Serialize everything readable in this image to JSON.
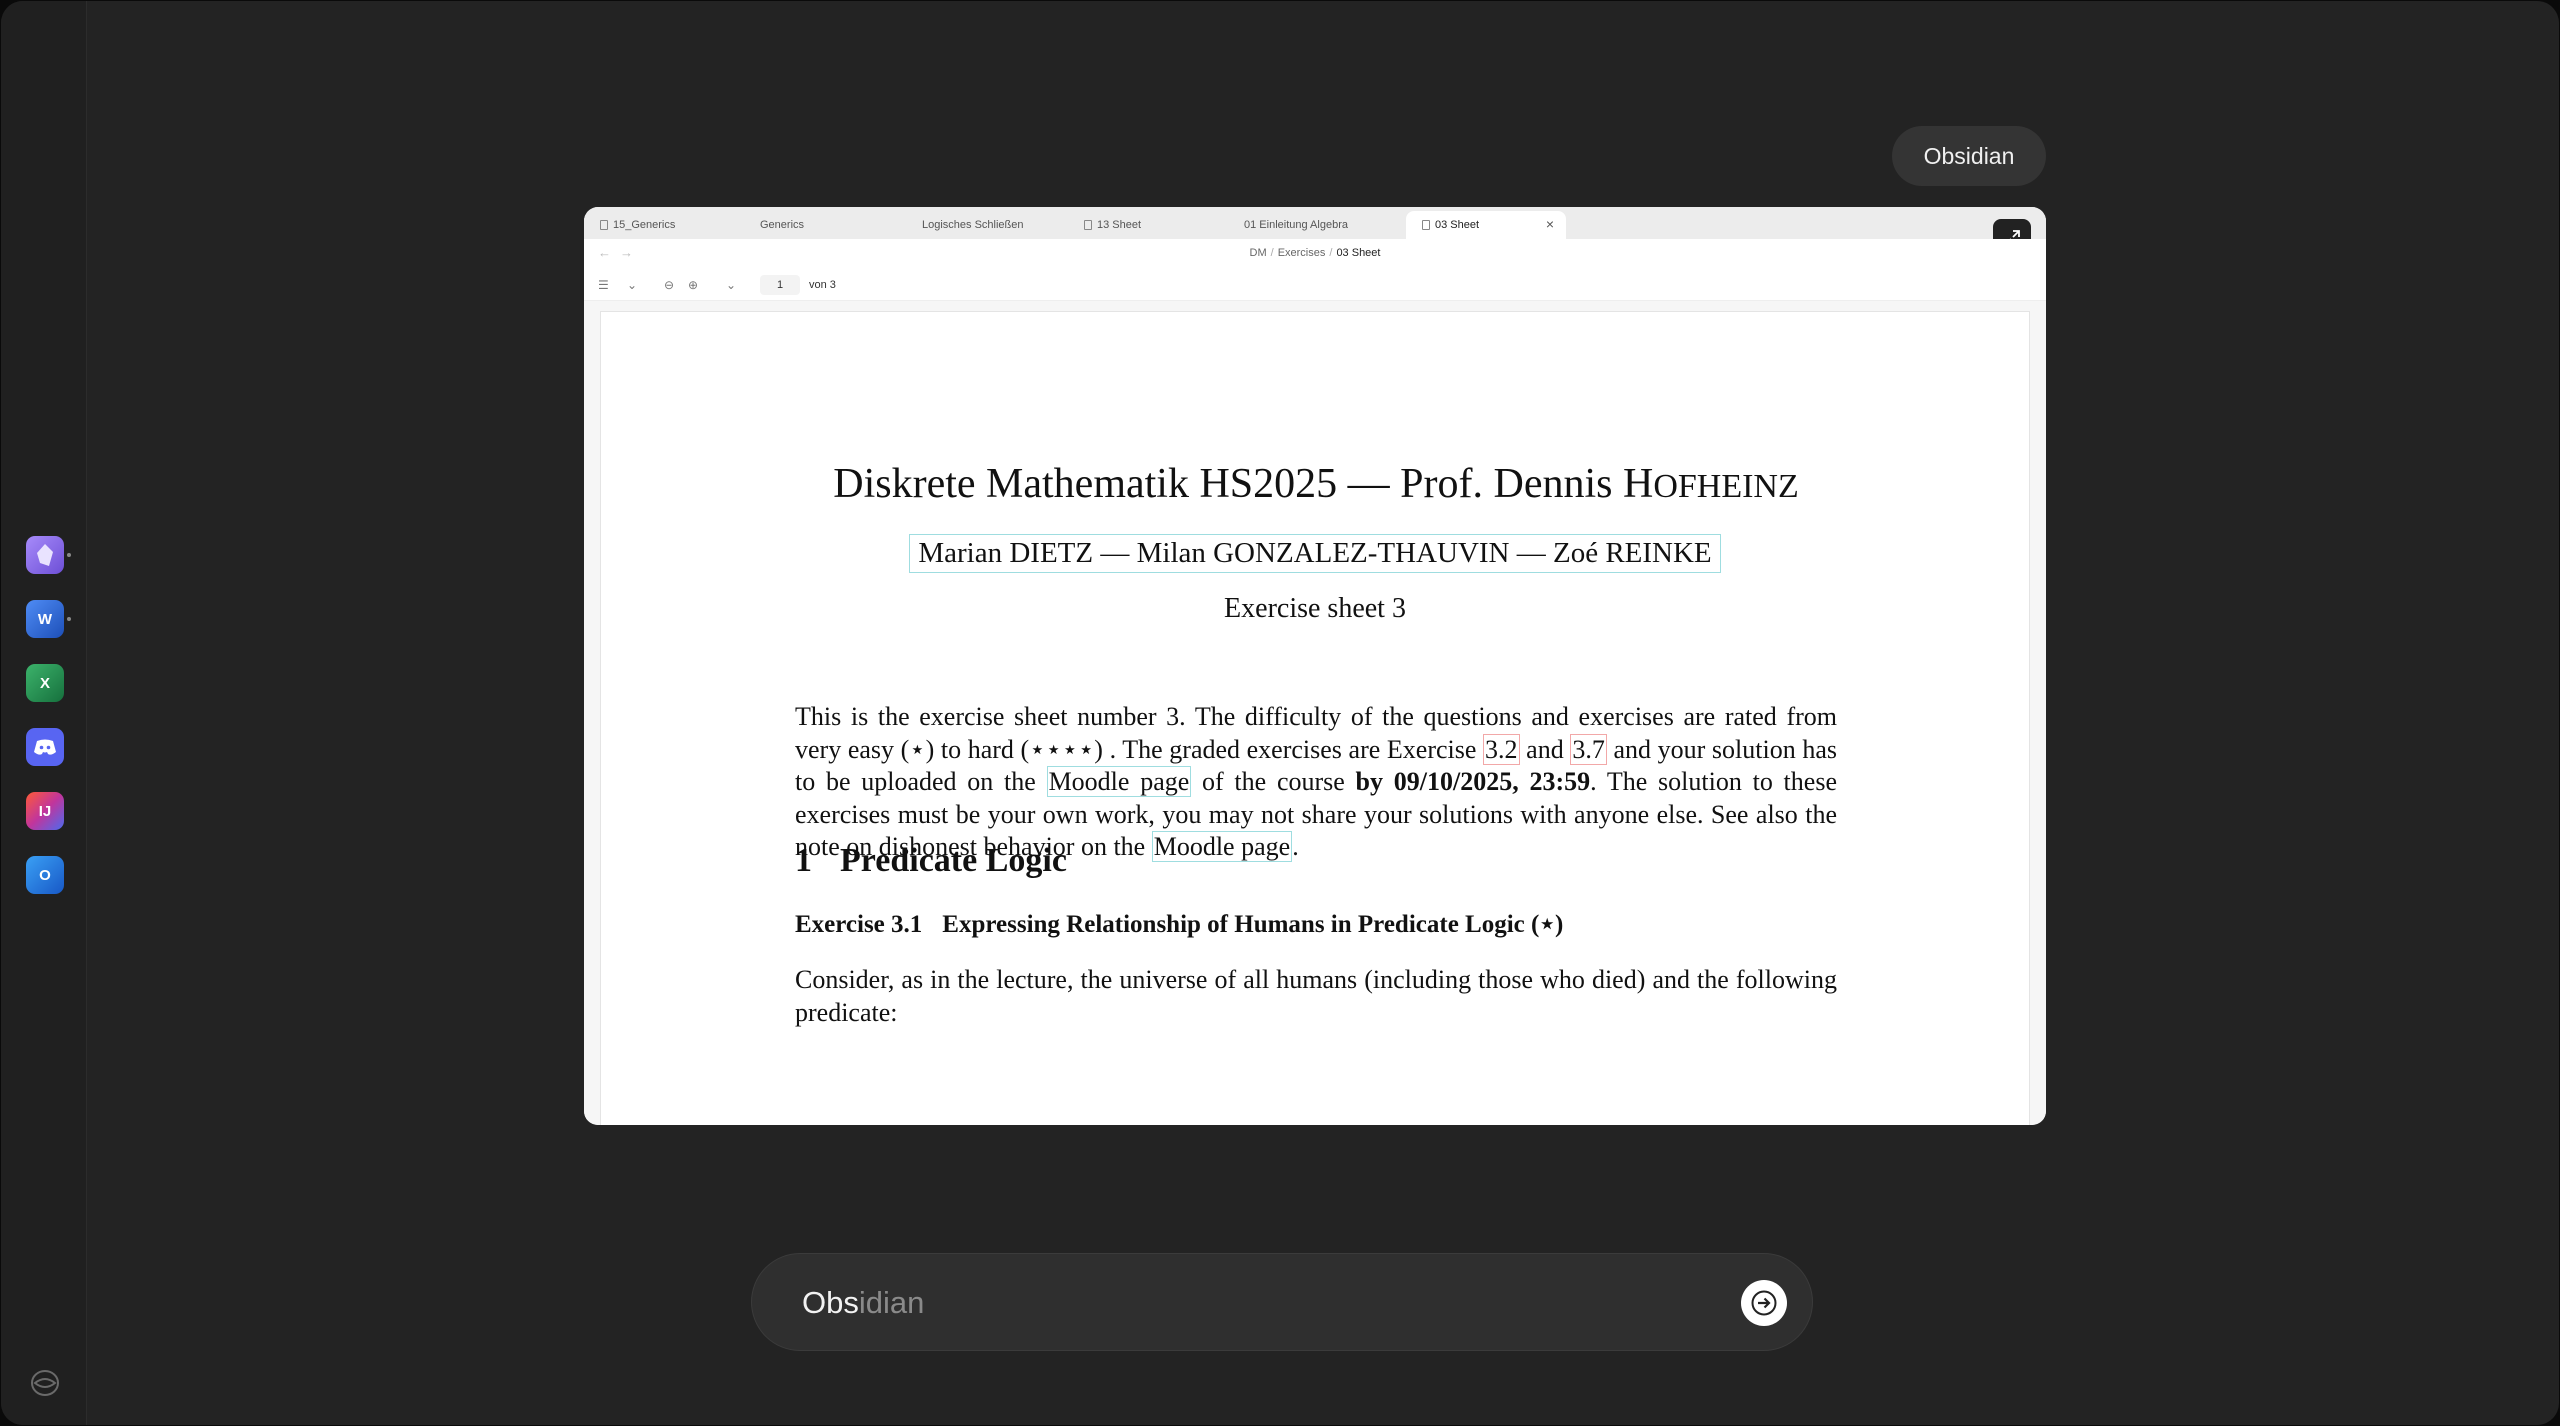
{
  "dock": {
    "apps": [
      {
        "name": "Obsidian",
        "color": "#7c5ce0"
      },
      {
        "name": "Microsoft Word",
        "color": "#2b66d6"
      },
      {
        "name": "Microsoft Excel",
        "color": "#1f8a4c"
      },
      {
        "name": "Discord",
        "color": "#5865f2"
      },
      {
        "name": "IntelliJ IDEA",
        "color": "#e8394f"
      },
      {
        "name": "Microsoft Outlook",
        "color": "#2a7be4"
      }
    ]
  },
  "app_pill": "Obsidian",
  "preview": {
    "tabs": [
      {
        "label": "15_Generics"
      },
      {
        "label": "Generics"
      },
      {
        "label": "Logisches Schließen"
      },
      {
        "label": "13 Sheet"
      },
      {
        "label": "01 Einleitung Algebra"
      },
      {
        "label": "03 Sheet"
      }
    ],
    "breadcrumb": [
      "DM",
      "Exercises",
      "03 Sheet"
    ],
    "toolbar": {
      "page": "1",
      "of": "von 3"
    }
  },
  "document": {
    "title_main": "Diskrete Mathematik HS2025 — Prof. Dennis H",
    "title_sc": "OFHEINZ",
    "authors": "Marian DIETZ — Milan GONZALEZ-THAUVIN — Zoé REINKE",
    "sheet": "Exercise sheet 3",
    "intro": {
      "p1": "This is the exercise sheet number 3. The difficulty of the questions and exercises are rated from very easy (⋆) to hard (⋆⋆⋆⋆) . The graded exercises are Exercise ",
      "ex_a": "3.2",
      "p2": " and ",
      "ex_b": "3.7",
      "p3": " and your solution has to be uploaded on the ",
      "link1": "Moodle page",
      "p4": " of the course ",
      "deadline": "by 09/10/2025, 23:59",
      "p5": ". The solution to these exercises must be your own work, you may not share your solutions with anyone else. See also the note on dishonest behavior on the ",
      "link2": "Moodle page",
      "p6": "."
    },
    "section": {
      "number": "1",
      "title": "Predicate Logic"
    },
    "exercise": {
      "number": "Exercise 3.1",
      "title": "Expressing Relationship of Humans in Predicate Logic (⋆)"
    },
    "consider": "Consider, as in the lecture, the universe of all humans (including those who died) and the following predicate:"
  },
  "search": {
    "typed": "Obs",
    "completion": "idian"
  }
}
